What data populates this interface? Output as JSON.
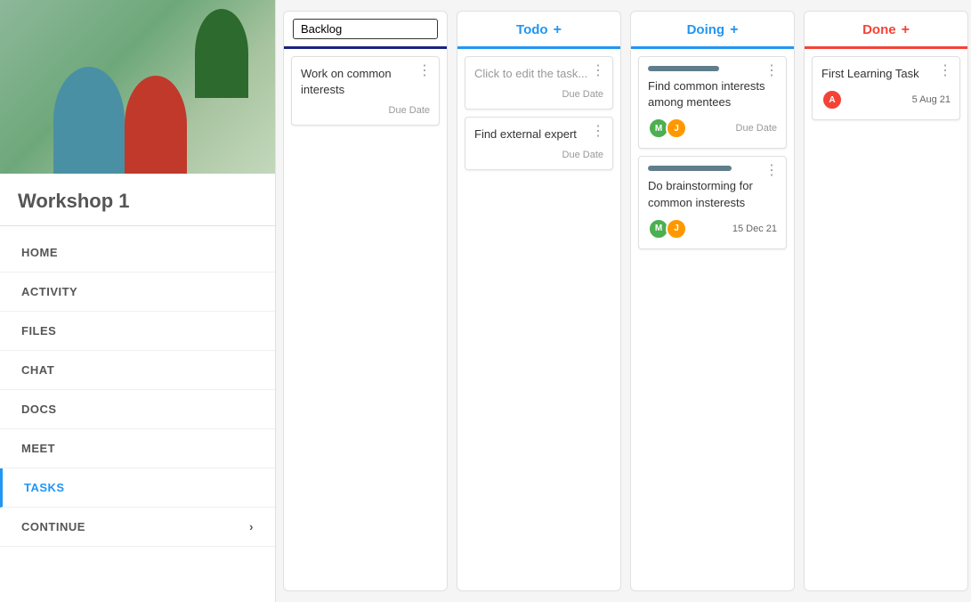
{
  "sidebar": {
    "title": "Workshop 1",
    "nav": [
      {
        "label": "HOME",
        "active": false
      },
      {
        "label": "ACTIVITY",
        "active": false
      },
      {
        "label": "FILES",
        "active": false
      },
      {
        "label": "CHAT",
        "active": false
      },
      {
        "label": "DOCS",
        "active": false
      },
      {
        "label": "MEET",
        "active": false
      },
      {
        "label": "TASKS",
        "active": true
      },
      {
        "label": "CONTINUE",
        "active": false
      }
    ]
  },
  "kanban": {
    "columns": [
      {
        "id": "backlog",
        "headerType": "input",
        "inputValue": "Backlog",
        "cards": [
          {
            "title": "Work on common interests",
            "dueLabel": "Due Date",
            "hasMenu": true
          }
        ]
      },
      {
        "id": "todo",
        "headerLabel": "Todo",
        "headerColor": "todo",
        "addButton": "+",
        "cards": [
          {
            "title": "Click to edit the task...",
            "dueLabel": "Due Date",
            "hasMenu": true
          },
          {
            "title": "Find external expert",
            "dueLabel": "Due Date",
            "hasMenu": true
          }
        ]
      },
      {
        "id": "doing",
        "headerLabel": "Doing",
        "headerColor": "doing",
        "addButton": "+",
        "cards": [
          {
            "title": "Find common interests among mentees",
            "dueLabel": "Due Date",
            "hasMenu": true,
            "hasAvatars": true,
            "avatars": [
              "green",
              "orange"
            ],
            "barWidth": "55%"
          },
          {
            "title": "Do brainstorming for common insterests",
            "hasMenu": true,
            "hasAvatars": true,
            "avatars": [
              "green",
              "orange"
            ],
            "date": "15 Dec 21",
            "barWidth": "65%"
          }
        ]
      },
      {
        "id": "done",
        "headerLabel": "Done",
        "headerColor": "done",
        "addButton": "+",
        "cards": [
          {
            "title": "First Learning Task",
            "hasMenu": true,
            "hasAvatars": true,
            "avatars": [
              "red"
            ],
            "date": "5 Aug 21"
          }
        ]
      }
    ]
  }
}
